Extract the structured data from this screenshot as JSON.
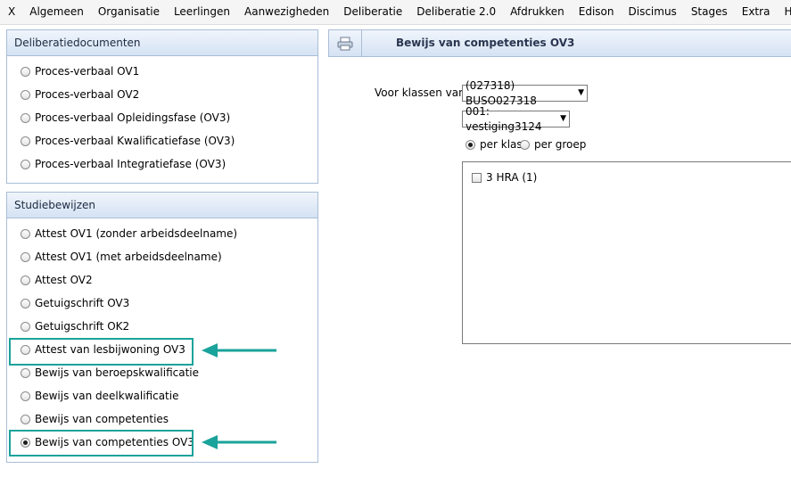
{
  "menu": [
    "X",
    "Algemeen",
    "Organisatie",
    "Leerlingen",
    "Aanwezigheden",
    "Deliberatie",
    "Deliberatie 2.0",
    "Afdrukken",
    "Edison",
    "Discimus",
    "Stages",
    "Extra",
    "Help"
  ],
  "deliberatie": {
    "title": "Deliberatiedocumenten",
    "items": [
      "Proces-verbaal OV1",
      "Proces-verbaal OV2",
      "Proces-verbaal Opleidingsfase (OV3)",
      "Proces-verbaal Kwalificatiefase (OV3)",
      "Proces-verbaal Integratiefase (OV3)"
    ]
  },
  "studiebewijzen": {
    "title": "Studiebewijzen",
    "items": [
      "Attest OV1 (zonder arbeidsdeelname)",
      "Attest OV1 (met arbeidsdeelname)",
      "Attest OV2",
      "Getuigschrift OV3",
      "Getuigschrift OK2",
      "Attest van lesbijwoning OV3",
      "Bewijs van beroepskwalificatie",
      "Bewijs van deelkwalificatie",
      "Bewijs van competenties",
      "Bewijs van competenties OV3"
    ],
    "selected": "Bewijs van competenties OV3"
  },
  "right": {
    "title": "Bewijs van competenties OV3",
    "voor_klassen_label": "Voor klassen van",
    "school_select": "(027318) BUSO027318",
    "vestiging_select": "001: vestiging3124",
    "per_klas": "per klas",
    "per_groep": "per groep",
    "class_item": "3 HRA (1)"
  },
  "colors": {
    "highlight": "#1aa39a",
    "panel_border": "#a9bdd8"
  }
}
